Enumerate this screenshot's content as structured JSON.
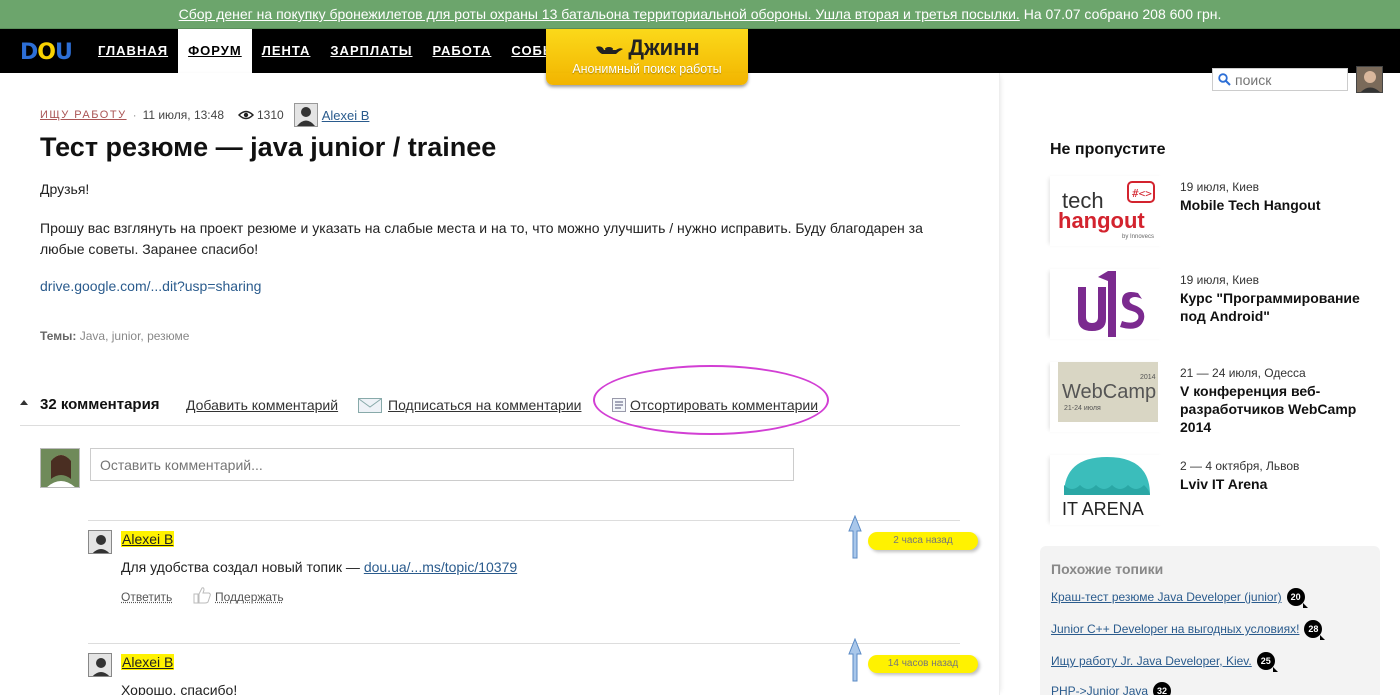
{
  "banner": {
    "link_text": "Сбор денег на покупку бронежилетов для роты охраны 13 батальона территориальной обороны. Ушла вторая и третья посылки.",
    "trail_text": "На 07.07 собрано 208 600 грн."
  },
  "nav": {
    "logo": "DOU",
    "items": [
      {
        "label": "ГЛАВНАЯ"
      },
      {
        "label": "ФОРУМ",
        "active": true
      },
      {
        "label": "ЛЕНТА"
      },
      {
        "label": "ЗАРПЛАТЫ"
      },
      {
        "label": "РАБОТА"
      },
      {
        "label": "СОБЫТИЯ"
      }
    ],
    "jinn_title": "Джинн",
    "jinn_sub": "Анонимный поиск работы",
    "search_placeholder": "поиск"
  },
  "post": {
    "category": "ИЩУ РАБОТУ",
    "date": "11 июля, 13:48",
    "views": "1310",
    "author": "Alexei B",
    "title": "Тест резюме — java junior / trainee",
    "p1": "Друзья!",
    "p2": "Прошу вас взглянуть на проект резюме и указать на слабые места и на то, что можно улучшить / нужно исправить. Буду благодарен за любые советы. Заранее спасибо!",
    "link": "drive.google.com/...dit?usp=sharing",
    "tags_label": "Темы:",
    "tags": "Java, junior, резюме"
  },
  "comments_bar": {
    "count": "32 комментария",
    "add": "Добавить комментарий",
    "subscribe": "Подписаться на комментарии",
    "sort": "Отсортировать комментарии"
  },
  "new_comment_placeholder": "Оставить комментарий...",
  "comments": [
    {
      "author": "Alexei B",
      "text_before": "Для удобства создал новый топик — ",
      "link": "dou.ua/...ms/topic/10379",
      "time": "2 часа назад",
      "reply": "Ответить",
      "like": "Поддержать"
    },
    {
      "author": "Alexei B",
      "text_before": "Хорошо, спасибо!",
      "link": "",
      "time": "14 часов назад",
      "reply": "Ответить",
      "like": "Поддержать"
    }
  ],
  "sidebar": {
    "title": "Не пропустите",
    "events": [
      {
        "date": "19 июля, Киев",
        "name": "Mobile Tech Hangout",
        "logo_name": "tech-hangout-logo"
      },
      {
        "date": "19 июля, Киев",
        "name": "Курс \"Программирование под Android\"",
        "logo_name": "uis-logo"
      },
      {
        "date": "21 — 24 июля, Одесса",
        "name": "V конференция веб-разработчиков WebCamp 2014",
        "logo_name": "webcamp-logo"
      },
      {
        "date": "2 — 4 октября, Львов",
        "name": "Lviv IT Arena",
        "logo_name": "it-arena-logo"
      }
    ],
    "logo_text": {
      "tech": "tech",
      "hangout": "hangout",
      "by": "by Innovecs",
      "webcamp": "WebCamp",
      "webcamp_year": "2014",
      "webcamp_dates": "21-24 июля",
      "itarena": "IT ARENA"
    },
    "related_title": "Похожие топики",
    "related": [
      {
        "label": "Краш-тест резюме Java Developer (junior)",
        "count": "20"
      },
      {
        "label": "Junior C++ Developer на выгодных условиях!",
        "count": "28"
      },
      {
        "label": "Ищу работу Jr. Java Developer, Kiev.",
        "count": "25"
      },
      {
        "label": "PHP->Junior Java",
        "count": "32"
      }
    ]
  },
  "colors": {
    "banner_bg": "#6ca56c",
    "nav_bg": "#000000",
    "jinn_bg": "#f6c70b",
    "highlight": "#fff200",
    "annotation_oval": "#d23fd4"
  }
}
